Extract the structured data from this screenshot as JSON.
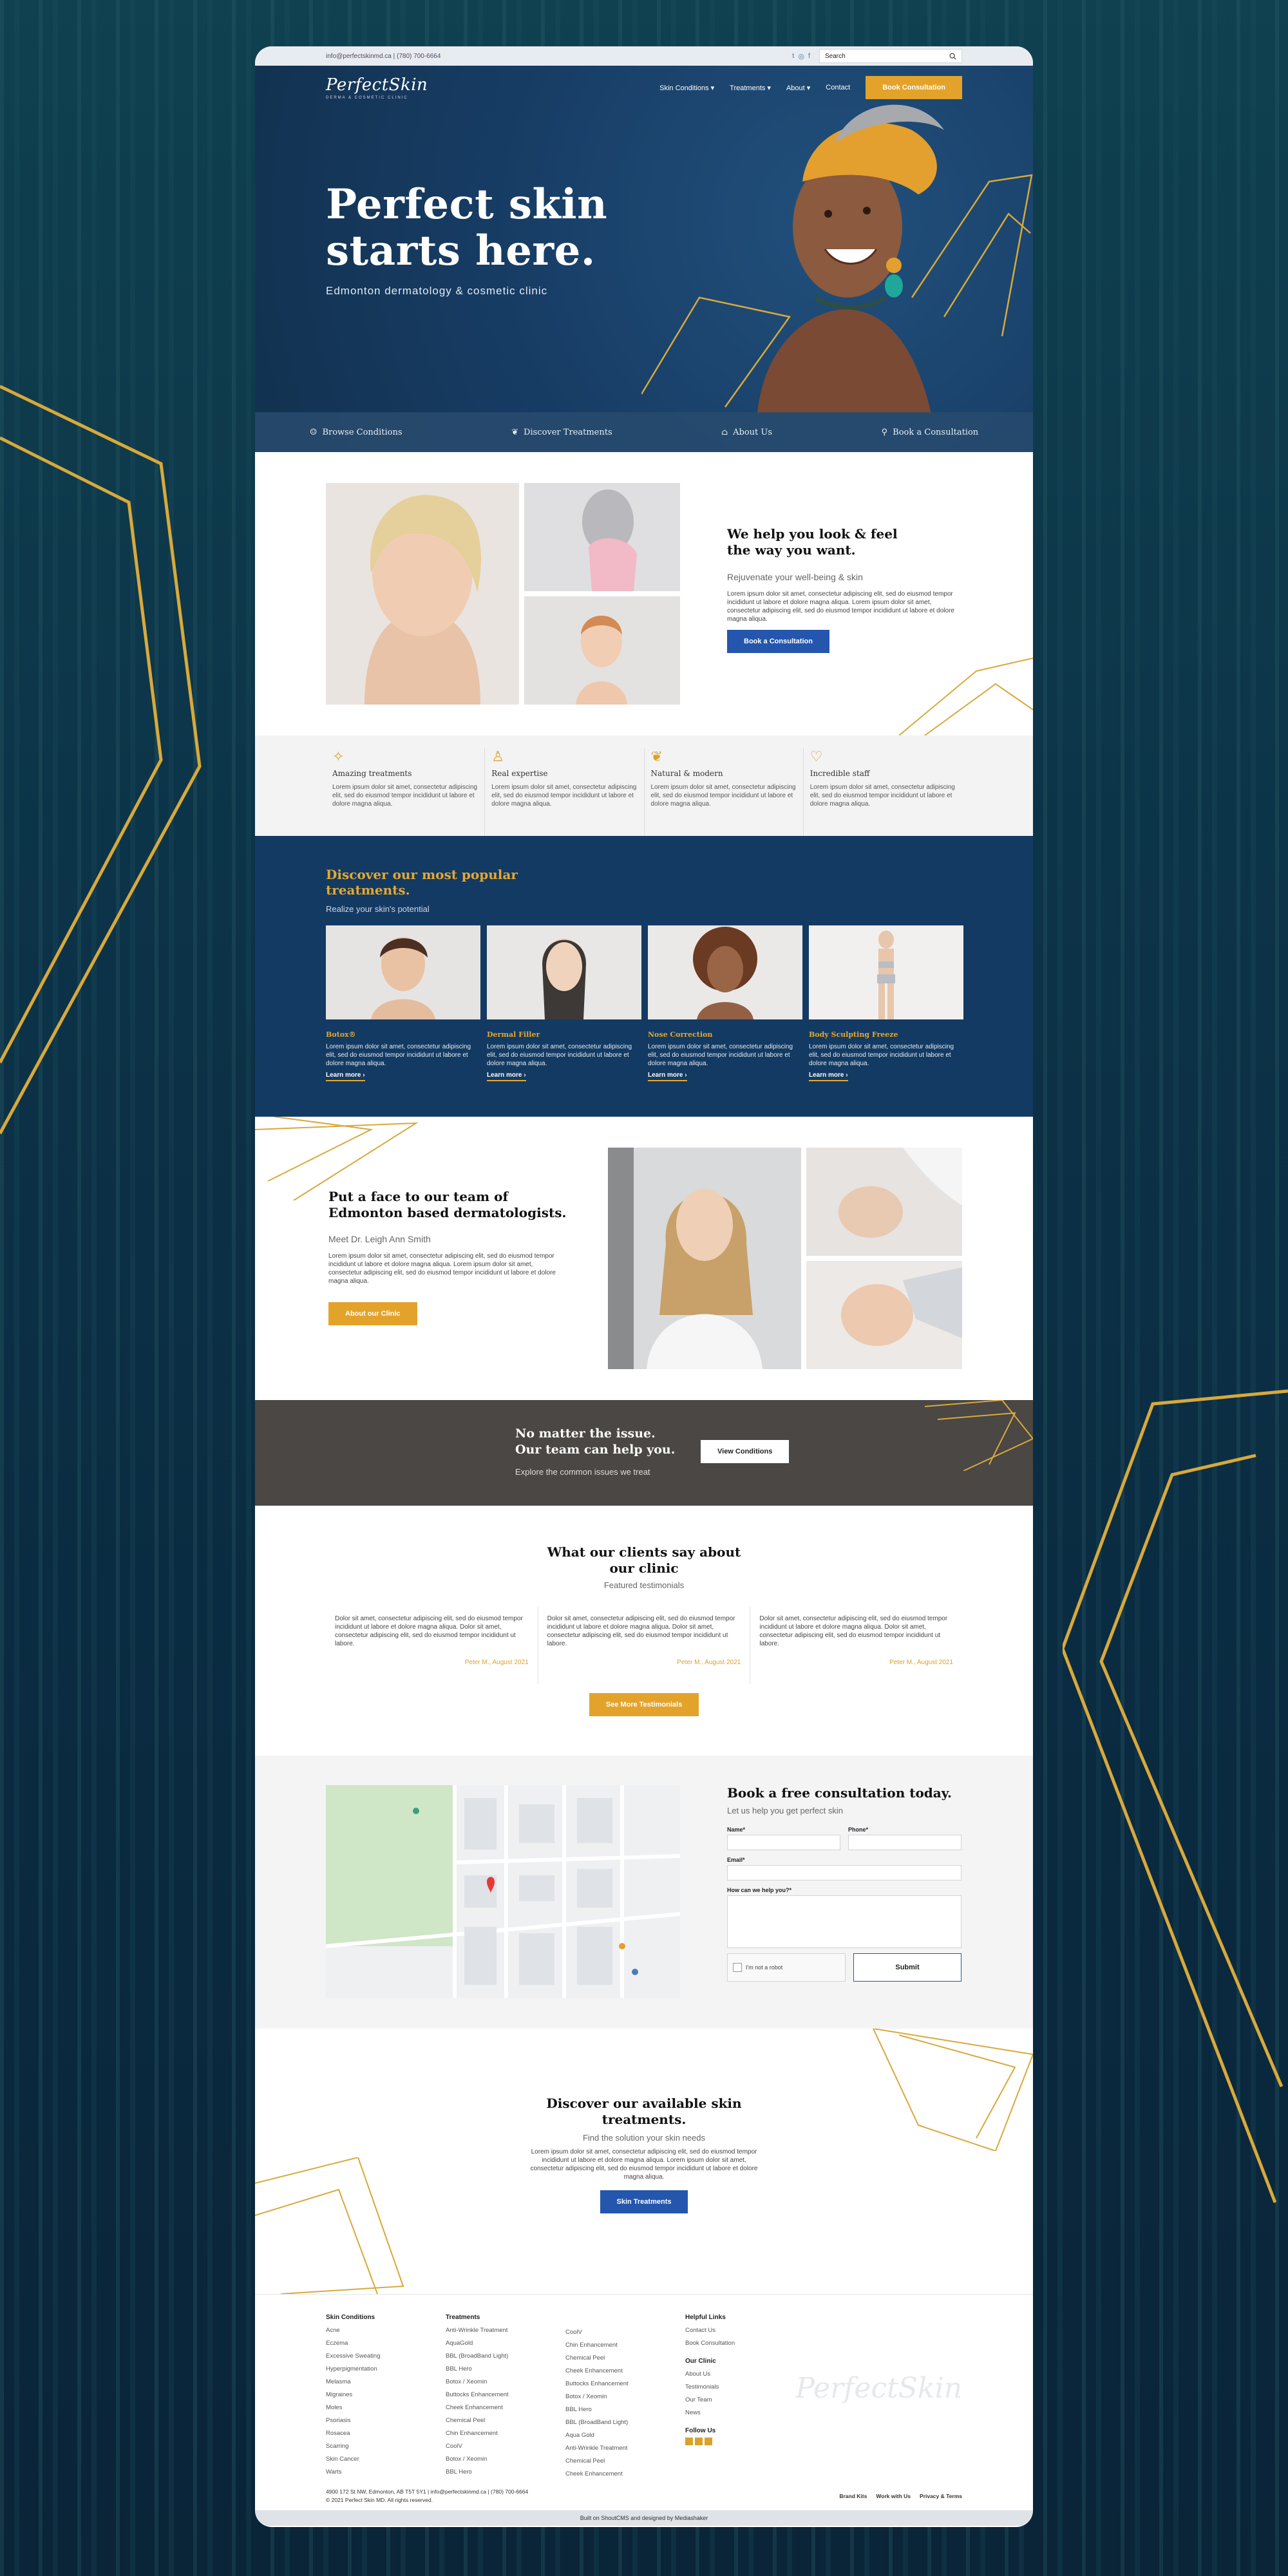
{
  "topbar": {
    "contact": "info@perfectskinmd.ca  |  (780) 700-6664",
    "social": [
      "t",
      "◎",
      "f"
    ],
    "search_placeholder": "Search"
  },
  "nav": {
    "logo_script": "PerfectSkin",
    "logo_sub": "DERMA & COSMETIC CLINIC",
    "links": [
      "Skin Conditions ▾",
      "Treatments ▾",
      "About ▾",
      "Contact"
    ],
    "cta": "Book Consultation"
  },
  "hero": {
    "title_line1": "Perfect skin",
    "title_line2": "starts here.",
    "tagline": "Edmonton dermatology & cosmetic clinic",
    "bar": [
      "Browse Conditions",
      "Discover Treatments",
      "About Us",
      "Book a Consultation"
    ]
  },
  "intro": {
    "title": "We help you look & feel the way you want.",
    "subtitle": "Rejuvenate your well-being & skin",
    "body": "Lorem ipsum dolor sit amet, consectetur adipiscing elit, sed do eiusmod tempor incididunt ut labore et dolore magna aliqua. Lorem ipsum dolor sit amet, consectetur adipiscing elit, sed do eiusmod tempor incididunt ut labore et dolore magna aliqua.",
    "cta": "Book a Consultation"
  },
  "features": [
    {
      "icon": "sparkle-icon",
      "glyph": "✧",
      "title": "Amazing treatments",
      "desc": "Lorem ipsum dolor sit amet, consectetur adipiscing elit, sed do eiusmod tempor incididunt ut labore et dolore magna aliqua."
    },
    {
      "icon": "person-icon",
      "glyph": "♙",
      "title": "Real expertise",
      "desc": "Lorem ipsum dolor sit amet, consectetur adipiscing elit, sed do eiusmod tempor incididunt ut labore et dolore magna aliqua."
    },
    {
      "icon": "leaf-icon",
      "glyph": "❦",
      "title": "Natural & modern",
      "desc": "Lorem ipsum dolor sit amet, consectetur adipiscing elit, sed do eiusmod tempor incididunt ut labore et dolore magna aliqua."
    },
    {
      "icon": "heart-icon",
      "glyph": "♡",
      "title": "Incredible staff",
      "desc": "Lorem ipsum dolor sit amet, consectetur adipiscing elit, sed do eiusmod tempor incididunt ut labore et dolore magna aliqua."
    }
  ],
  "treatments": {
    "title": "Discover our most popular treatments.",
    "subtitle": "Realize your skin's potential",
    "cards": [
      {
        "name": "Botox®",
        "desc": "Lorem ipsum dolor sit amet, consectetur adipiscing elit, sed do eiusmod tempor incididunt ut labore et dolore magna aliqua.",
        "more": "Learn more  ›"
      },
      {
        "name": "Dermal Filler",
        "desc": "Lorem ipsum dolor sit amet, consectetur adipiscing elit, sed do eiusmod tempor incididunt ut labore et dolore magna aliqua.",
        "more": "Learn more  ›"
      },
      {
        "name": "Nose Correction",
        "desc": "Lorem ipsum dolor sit amet, consectetur adipiscing elit, sed do eiusmod tempor incididunt ut labore et dolore magna aliqua.",
        "more": "Learn more  ›"
      },
      {
        "name": "Body Sculpting Freeze",
        "desc": "Lorem ipsum dolor sit amet, consectetur adipiscing elit, sed do eiusmod tempor incididunt ut labore et dolore magna aliqua.",
        "more": "Learn more  ›"
      }
    ]
  },
  "team": {
    "title": "Put a face to our team of Edmonton based dermatologists.",
    "subtitle": "Meet Dr. Leigh Ann Smith",
    "body": "Lorem ipsum dolor sit amet, consectetur adipiscing elit, sed do eiusmod tempor incididunt ut labore et dolore magna aliqua. Lorem ipsum dolor sit amet, consectetur adipiscing elit, sed do eiusmod tempor incididunt ut labore et dolore magna aliqua.",
    "cta": "About our Clinic"
  },
  "band": {
    "title_line1": "No matter the issue.",
    "title_line2": "Our team can help you.",
    "subtitle": "Explore the common issues we treat",
    "cta": "View Conditions"
  },
  "testimonials": {
    "title_line1": "What our clients say about",
    "title_line2": "our clinic",
    "subtitle": "Featured testimonials",
    "items": [
      {
        "quote": "Dolor sit amet, consectetur adipiscing elit, sed do eiusmod tempor incididunt ut labore et dolore magna aliqua. Dolor sit amet, consectetur adipiscing elit, sed do eiusmod tempor incididunt ut labore.",
        "author": "Peter M., August 2021"
      },
      {
        "quote": "Dolor sit amet, consectetur adipiscing elit, sed do eiusmod tempor incididunt ut labore et dolore magna aliqua. Dolor sit amet, consectetur adipiscing elit, sed do eiusmod tempor incididunt ut labore.",
        "author": "Peter M., August 2021"
      },
      {
        "quote": "Dolor sit amet, consectetur adipiscing elit, sed do eiusmod tempor incididunt ut labore et dolore magna aliqua. Dolor sit amet, consectetur adipiscing elit, sed do eiusmod tempor incididunt ut labore.",
        "author": "Peter M., August 2021"
      }
    ],
    "cta": "See More Testimonials"
  },
  "consult": {
    "title": "Book a free consultation today.",
    "subtitle": "Let us help you get perfect skin",
    "labels": {
      "name": "Name*",
      "phone": "Phone*",
      "email": "Email*",
      "help": "How can we help you?*"
    },
    "captcha": "I'm not a robot",
    "submit": "Submit"
  },
  "discover": {
    "title_line1": "Discover our available skin",
    "title_line2": "treatments.",
    "subtitle": "Find the solution your skin needs",
    "body": "Lorem ipsum dolor sit amet, consectetur adipiscing elit, sed do eiusmod tempor incididunt ut labore et dolore magna aliqua. Lorem ipsum dolor sit amet, consectetur adipiscing elit, sed do eiusmod tempor incididunt ut labore et dolore magna aliqua.",
    "cta": "Skin Treatments"
  },
  "footer": {
    "col1": {
      "title": "Skin Conditions",
      "links": [
        "Acne",
        "Eczema",
        "Excessive Sweating",
        "Hyperpigmentation",
        "Melasma",
        "Migraines",
        "Moles",
        "Psoriasis",
        "Rosacea",
        "Scarring",
        "Skin Cancer",
        "Warts"
      ]
    },
    "col2": {
      "title": "Treatments",
      "links": [
        "Anti-Wrinkle Treatment",
        "AquaGold",
        "BBL (BroadBand Light)",
        "BBL Hero",
        "Botox / Xeomin",
        "Buttocks Enhancement",
        "Cheek Enhancement",
        "Chemical Peel",
        "Chin Enhancement",
        "CoolV",
        "Botox / Xeomin",
        "BBL Hero"
      ]
    },
    "col3": {
      "title": "",
      "links": [
        "CoolV",
        "Chin Enhancement",
        "Chemical Peel",
        "Cheek Enhancement",
        "Buttocks Enhancement",
        "Botox / Xeomin",
        "BBL Hero",
        "BBL (BroadBand Light)",
        "Aqua Gold",
        "Anti-Wrinkle Treatment",
        "Chemical Peel",
        "Cheek Enhancement"
      ]
    },
    "col4a": {
      "title": "Helpful Links",
      "links": [
        "Contact Us",
        "Book Consultation"
      ]
    },
    "col4b": {
      "title": "Our Clinic",
      "links": [
        "About Us",
        "Testimonials",
        "Our Team",
        "News"
      ]
    },
    "col4c": {
      "title": "Follow Us"
    },
    "logo": "PerfectSkin",
    "address": "4900 172 St NW, Edmonton, AB T5T 5Y1  |  info@perfectskinmd.ca  |  (780) 700-6664",
    "copyright": "© 2021 Perfect Skin MD. All rights reserved.",
    "bottom_links": [
      "Brand Kits",
      "Work with Us",
      "Privacy & Terms"
    ],
    "built": "Built on ShoutCMS and designed by Mediashaker"
  }
}
